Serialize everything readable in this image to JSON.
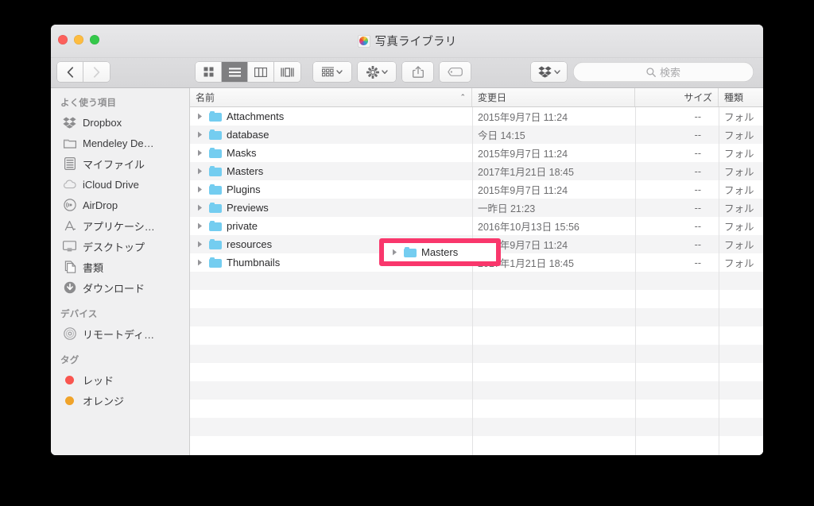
{
  "window": {
    "title": "写真ライブラリ",
    "app_icon": "photos-library-icon",
    "traffic_lights": {
      "close_color": "#fc605c",
      "minimize_color": "#fdbc40",
      "maximize_color": "#34c84a"
    }
  },
  "toolbar": {
    "back_icon": "chevron-left-icon",
    "forward_icon": "chevron-right-icon",
    "view_icon_label": "icon-view-icon",
    "view_list_label": "list-view-icon",
    "view_column_label": "column-view-icon",
    "view_gallery_label": "gallery-view-icon",
    "arrange_icon": "arrange-by-icon",
    "action_icon": "gear-icon",
    "share_icon": "share-icon",
    "tag_icon": "tag-icon",
    "dropbox_icon": "dropbox-icon",
    "chevron_icon": "chevron-down-icon",
    "active_view": "list"
  },
  "search": {
    "icon": "search-icon",
    "placeholder": "検索",
    "value": ""
  },
  "sidebar": {
    "sections": [
      {
        "title": "よく使う項目",
        "items": [
          {
            "label": "Dropbox",
            "icon": "dropbox-icon"
          },
          {
            "label": "Mendeley De…",
            "icon": "folder-icon"
          },
          {
            "label": "マイファイル",
            "icon": "all-my-files-icon"
          },
          {
            "label": "iCloud Drive",
            "icon": "cloud-icon"
          },
          {
            "label": "AirDrop",
            "icon": "airdrop-icon"
          },
          {
            "label": "アプリケーシ…",
            "icon": "applications-icon"
          },
          {
            "label": "デスクトップ",
            "icon": "desktop-icon"
          },
          {
            "label": "書類",
            "icon": "documents-icon"
          },
          {
            "label": "ダウンロード",
            "icon": "downloads-icon"
          }
        ]
      },
      {
        "title": "デバイス",
        "items": [
          {
            "label": "リモートディ…",
            "icon": "remote-disc-icon"
          }
        ]
      },
      {
        "title": "タグ",
        "items": [
          {
            "label": "レッド",
            "icon": "tag-dot-icon",
            "color": "#f9554f"
          },
          {
            "label": "オレンジ",
            "icon": "tag-dot-icon",
            "color": "#f0a32a"
          }
        ]
      }
    ]
  },
  "file_list": {
    "columns": [
      {
        "key": "name",
        "label": "名前",
        "sorted": true,
        "sort_direction": "ascending",
        "sort_caret": "⌃"
      },
      {
        "key": "date",
        "label": "変更日",
        "sorted": false
      },
      {
        "key": "size",
        "label": "サイズ",
        "sorted": false
      },
      {
        "key": "kind",
        "label": "種類",
        "sorted": false
      }
    ],
    "rows": [
      {
        "name": "Attachments",
        "date": "2015年9月7日 11:24",
        "size": "--",
        "kind": "フォル",
        "icon": "folder-icon",
        "disclosure": "▶"
      },
      {
        "name": "database",
        "date": "今日 14:15",
        "size": "--",
        "kind": "フォル",
        "icon": "folder-icon",
        "disclosure": "▶"
      },
      {
        "name": "Masks",
        "date": "2015年9月7日 11:24",
        "size": "--",
        "kind": "フォル",
        "icon": "folder-icon",
        "disclosure": "▶"
      },
      {
        "name": "Masters",
        "date": "2017年1月21日 18:45",
        "size": "--",
        "kind": "フォル",
        "icon": "folder-icon",
        "disclosure": "▶"
      },
      {
        "name": "Plugins",
        "date": "2015年9月7日 11:24",
        "size": "--",
        "kind": "フォル",
        "icon": "folder-icon",
        "disclosure": "▶"
      },
      {
        "name": "Previews",
        "date": "一昨日 21:23",
        "size": "--",
        "kind": "フォル",
        "icon": "folder-icon",
        "disclosure": "▶"
      },
      {
        "name": "private",
        "date": "2016年10月13日 15:56",
        "size": "--",
        "kind": "フォル",
        "icon": "folder-icon",
        "disclosure": "▶"
      },
      {
        "name": "resources",
        "date": "2015年9月7日 11:24",
        "size": "--",
        "kind": "フォル",
        "icon": "folder-icon",
        "disclosure": "▶"
      },
      {
        "name": "Thumbnails",
        "date": "2017年1月21日 18:45",
        "size": "--",
        "kind": "フォル",
        "icon": "folder-icon",
        "disclosure": "▶"
      }
    ]
  },
  "annotation": {
    "target_label": "Masters",
    "disclosure": "▶",
    "border_color": "#f9376c"
  }
}
